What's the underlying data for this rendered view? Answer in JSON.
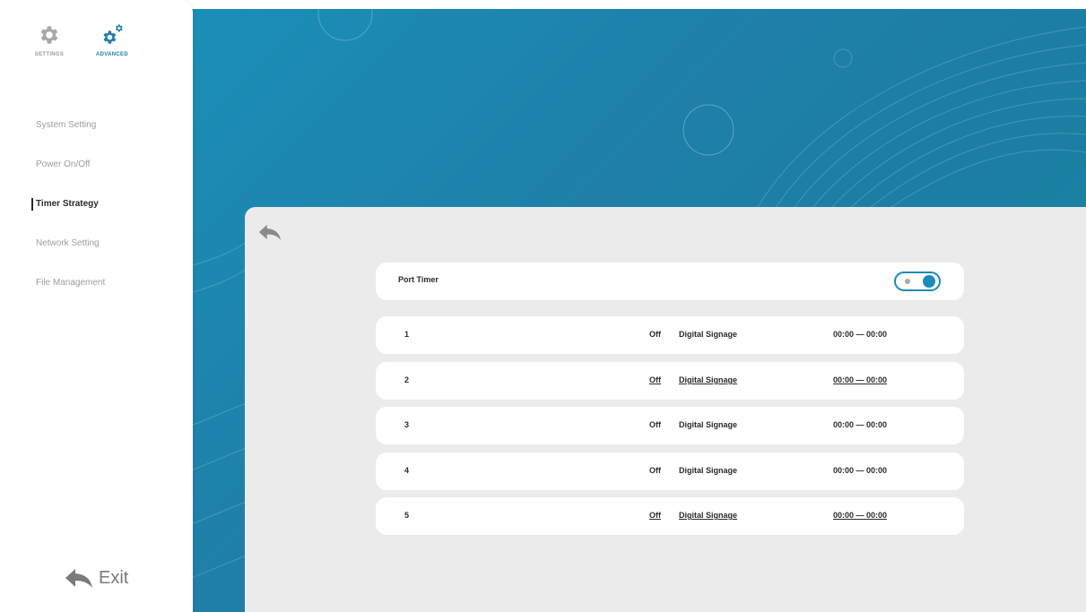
{
  "sidebar": {
    "tabs": [
      {
        "label": "SETTINGS",
        "icon": "gear-icon",
        "active": false
      },
      {
        "label": "ADVANCED",
        "icon": "gears-icon",
        "active": true
      }
    ],
    "items": [
      {
        "label": "System Setting"
      },
      {
        "label": "Power On/Off"
      },
      {
        "label": "Timer Strategy"
      },
      {
        "label": "Network Setting"
      },
      {
        "label": "File Management"
      }
    ],
    "active_index": 2,
    "exit_label": "Exit"
  },
  "panel": {
    "port_timer": {
      "label": "Port Timer",
      "enabled": true
    },
    "rows": [
      {
        "num": "1",
        "state": "Off",
        "source": "Digital Signage",
        "time": "00:00 — 00:00"
      },
      {
        "num": "2",
        "state": "Off",
        "source": "Digital Signage",
        "time": "00:00 — 00:00"
      },
      {
        "num": "3",
        "state": "Off",
        "source": "Digital Signage",
        "time": "00:00 — 00:00"
      },
      {
        "num": "4",
        "state": "Off",
        "source": "Digital Signage",
        "time": "00:00 — 00:00"
      },
      {
        "num": "5",
        "state": "Off",
        "source": "Digital Signage",
        "time": "00:00 — 00:00"
      }
    ]
  },
  "colors": {
    "accent": "#1b8bb8",
    "background_blue": "#1f7fa8",
    "panel": "#ebebeb"
  }
}
